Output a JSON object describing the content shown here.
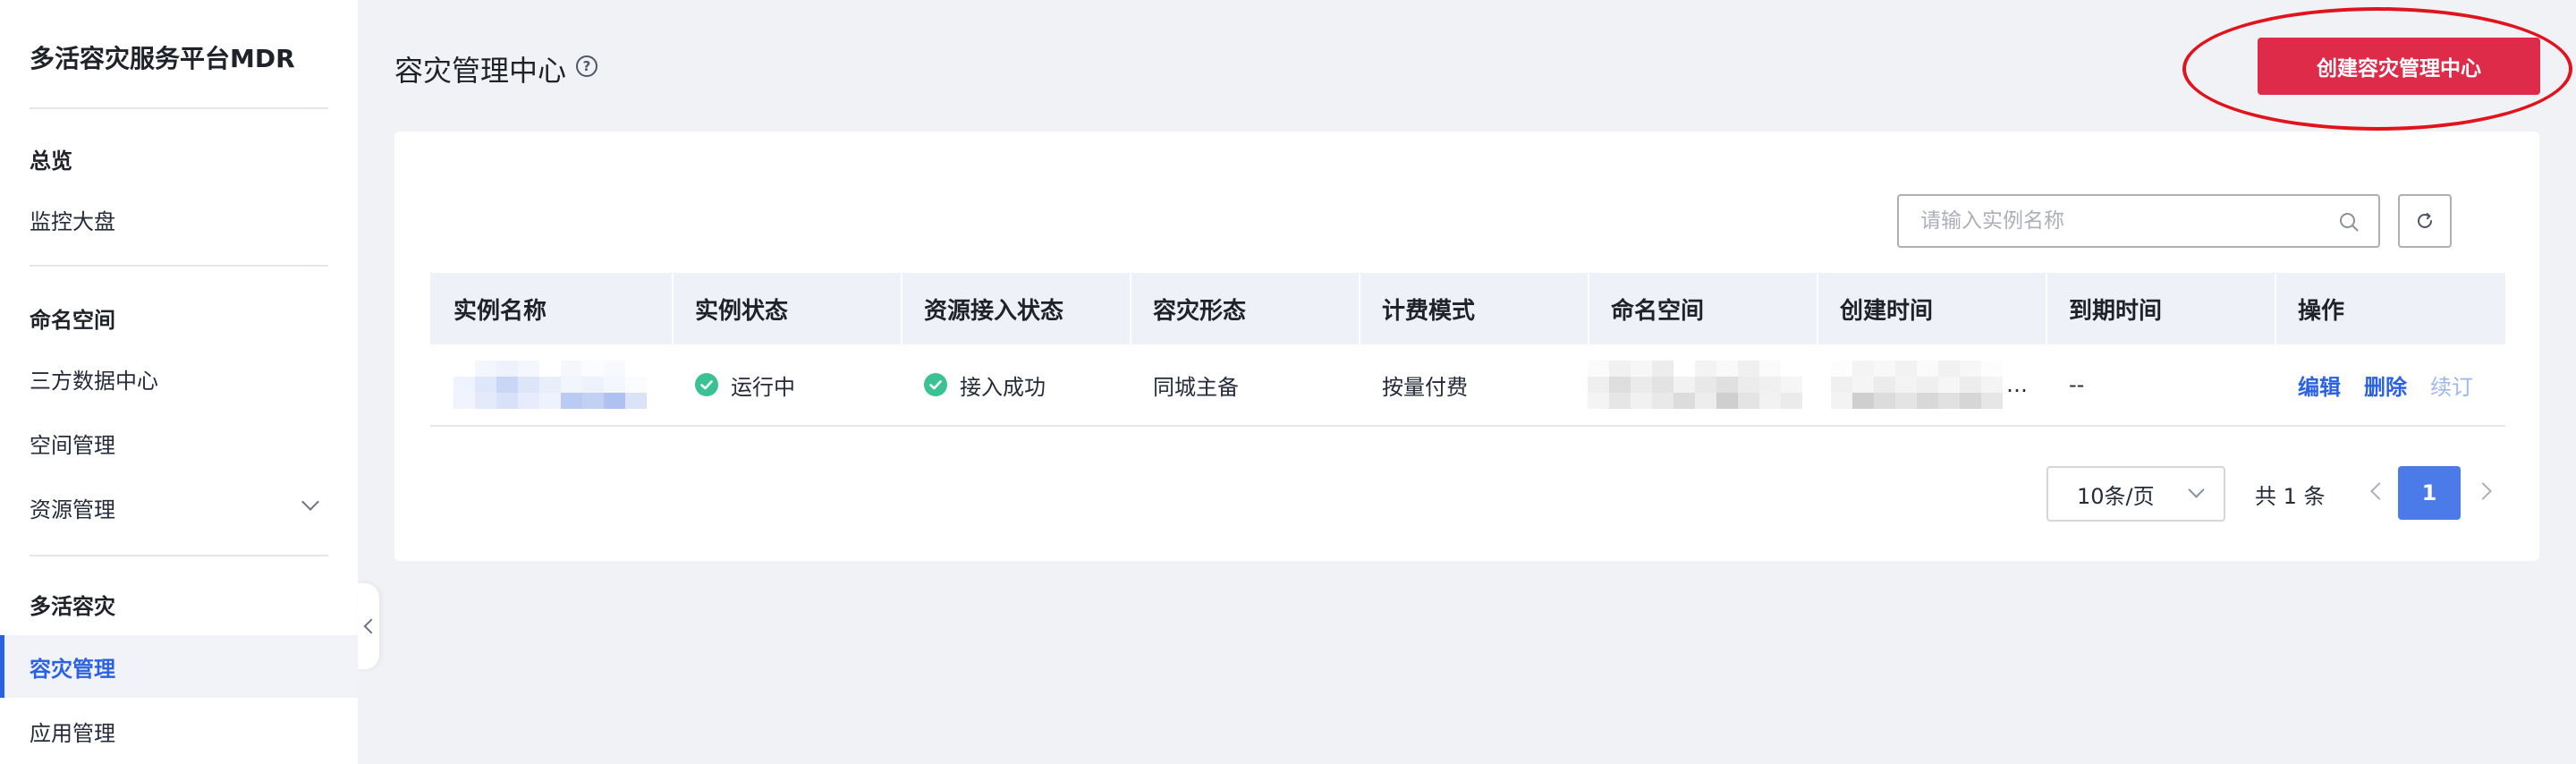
{
  "sidebar": {
    "brand": "多活容灾服务平台MDR",
    "groups": [
      {
        "title": "总览",
        "items": [
          {
            "label": "监控大盘"
          }
        ]
      },
      {
        "title": "命名空间",
        "items": [
          {
            "label": "三方数据中心"
          },
          {
            "label": "空间管理"
          },
          {
            "label": "资源管理"
          }
        ]
      },
      {
        "title": "多活容灾",
        "items": [
          {
            "label": "容灾管理"
          },
          {
            "label": "应用管理"
          }
        ]
      }
    ],
    "active_item": "容灾管理"
  },
  "header": {
    "title": "容灾管理中心",
    "help_icon": "question-circle-icon",
    "create_button": "创建容灾管理中心"
  },
  "toolbar": {
    "search_placeholder": "请输入实例名称",
    "search_icon": "search-icon",
    "refresh_icon": "refresh-icon"
  },
  "table": {
    "columns": [
      "实例名称",
      "实例状态",
      "资源接入状态",
      "容灾形态",
      "计费模式",
      "命名空间",
      "创建时间",
      "到期时间",
      "操作"
    ],
    "rows": [
      {
        "instance_name": "",
        "instance_status": "运行中",
        "resource_status": "接入成功",
        "dr_mode": "同城主备",
        "billing": "按量付费",
        "namespace": "",
        "created_time": "…",
        "expire_time": "--",
        "actions": [
          "编辑",
          "删除",
          "续订"
        ]
      }
    ]
  },
  "pagination": {
    "page_size": "10条/页",
    "total": "共 1 条",
    "current_page": "1"
  },
  "colors": {
    "primary": "#2a62e3",
    "danger": "#de2b4a",
    "success": "#3ac295",
    "annotation": "#e0141c"
  }
}
